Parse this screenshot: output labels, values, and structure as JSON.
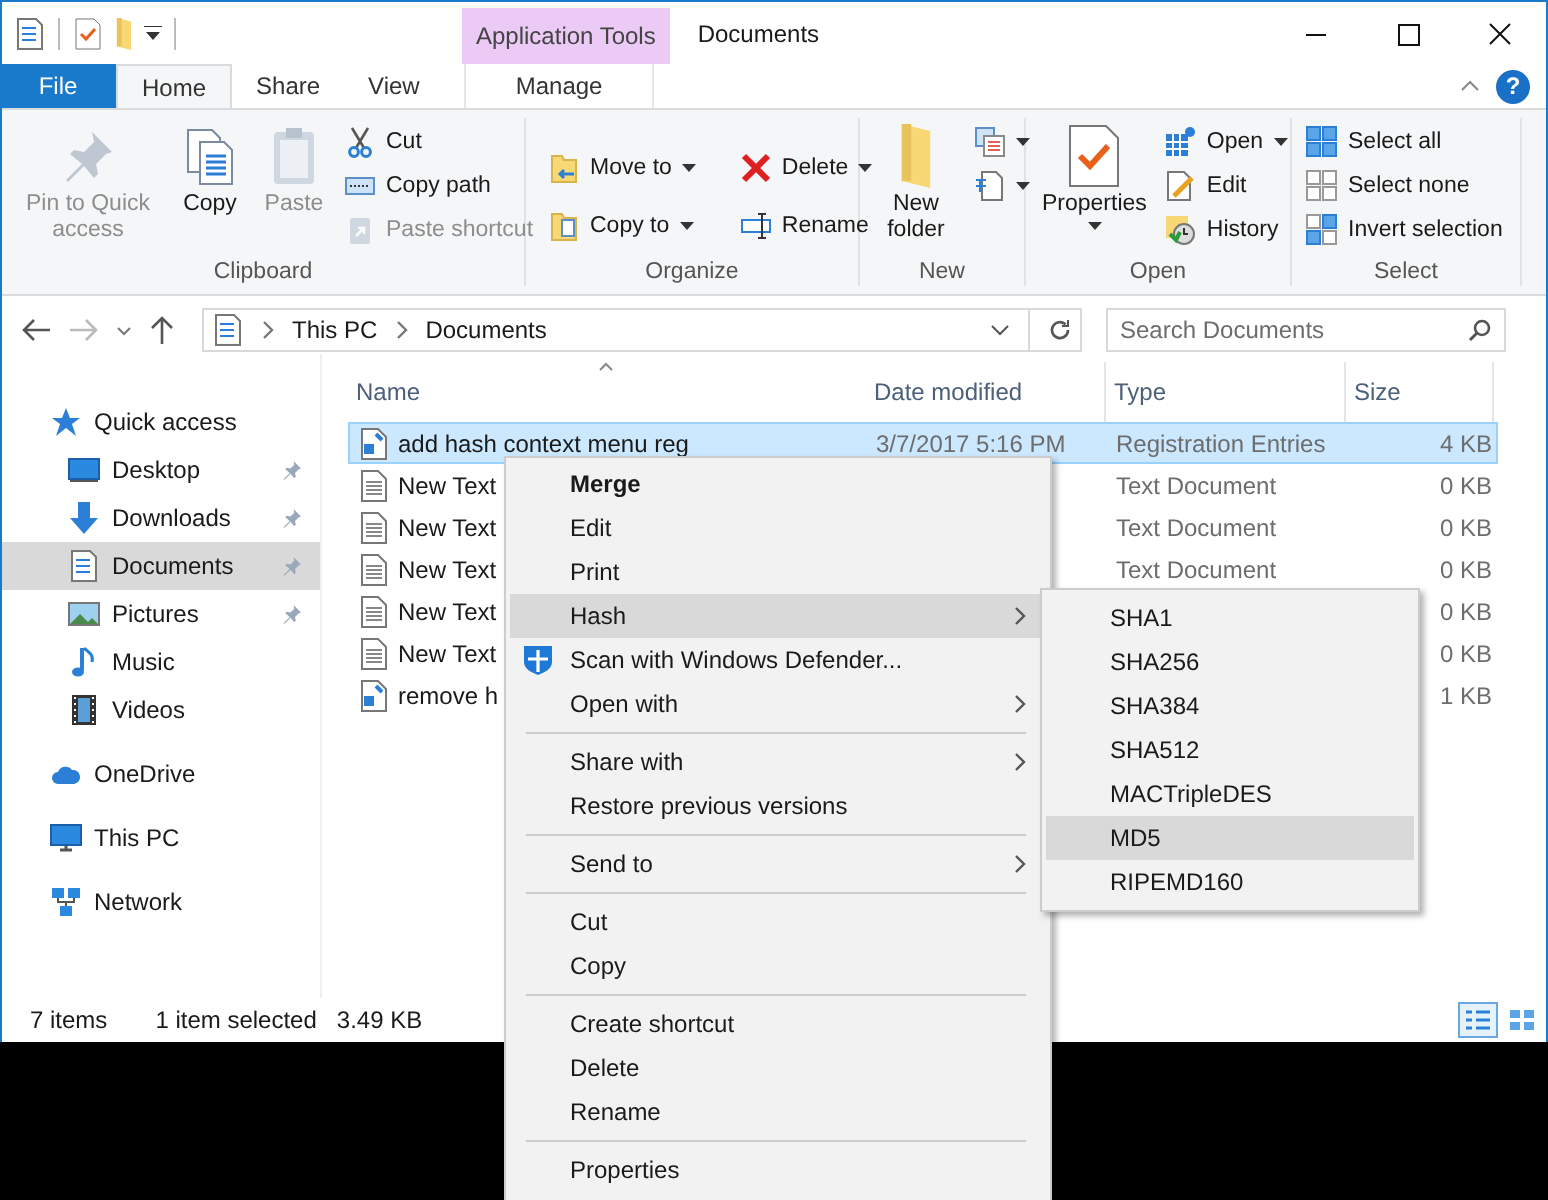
{
  "window": {
    "title": "Documents",
    "contextual_tab_group": "Application Tools",
    "help": "?"
  },
  "ribbon_tabs": [
    {
      "label": "File",
      "kind": "file",
      "selected": false
    },
    {
      "label": "Home",
      "kind": "tab",
      "selected": true
    },
    {
      "label": "Share",
      "kind": "tab",
      "selected": false
    },
    {
      "label": "View",
      "kind": "tab",
      "selected": false
    },
    {
      "label": "Manage",
      "kind": "contextual",
      "selected": false
    }
  ],
  "ribbon_groups": [
    {
      "label": "Clipboard",
      "large_buttons": [
        {
          "label": "Pin to Quick access",
          "disabled": true,
          "dropdown": false
        },
        {
          "label": "Copy",
          "disabled": false,
          "dropdown": false
        },
        {
          "label": "Paste",
          "disabled": true,
          "dropdown": false
        }
      ],
      "small_buttons": [
        {
          "label": "Cut",
          "disabled": false,
          "dropdown": false
        },
        {
          "label": "Copy path",
          "disabled": false,
          "dropdown": false
        },
        {
          "label": "Paste shortcut",
          "disabled": true,
          "dropdown": false
        }
      ]
    },
    {
      "label": "Organize",
      "small_buttons": [
        {
          "label": "Move to",
          "disabled": false,
          "dropdown": true
        },
        {
          "label": "Copy to",
          "disabled": false,
          "dropdown": true
        },
        {
          "label": "Delete",
          "disabled": false,
          "dropdown": true
        },
        {
          "label": "Rename",
          "disabled": false,
          "dropdown": false
        }
      ]
    },
    {
      "label": "New",
      "large_buttons": [
        {
          "label": "New folder",
          "disabled": false,
          "dropdown": false
        }
      ],
      "small_buttons": [
        {
          "disabled": false,
          "dropdown": true
        },
        {
          "disabled": false,
          "dropdown": true
        }
      ]
    },
    {
      "label": "Open",
      "large_buttons": [
        {
          "label": "Properties",
          "disabled": false,
          "dropdown": true
        }
      ],
      "small_buttons": [
        {
          "label": "Open",
          "disabled": false,
          "dropdown": true
        },
        {
          "label": "Edit",
          "disabled": false,
          "dropdown": false
        },
        {
          "label": "History",
          "disabled": false,
          "dropdown": false
        }
      ]
    },
    {
      "label": "Select",
      "small_buttons": [
        {
          "label": "Select all",
          "disabled": false,
          "dropdown": false
        },
        {
          "label": "Select none",
          "disabled": false,
          "dropdown": false
        },
        {
          "label": "Invert selection",
          "disabled": false,
          "dropdown": false
        }
      ]
    }
  ],
  "address_bar": {
    "path": [
      "This PC",
      "Documents"
    ]
  },
  "search": {
    "placeholder": "Search Documents"
  },
  "navigation_pane": [
    {
      "label": "Quick access",
      "selected": false,
      "pinned": false,
      "children": [
        {
          "label": "Desktop",
          "selected": false,
          "pinned": true
        },
        {
          "label": "Downloads",
          "selected": false,
          "pinned": true
        },
        {
          "label": "Documents",
          "selected": true,
          "pinned": true
        },
        {
          "label": "Pictures",
          "selected": false,
          "pinned": true
        },
        {
          "label": "Music",
          "selected": false,
          "pinned": false
        },
        {
          "label": "Videos",
          "selected": false,
          "pinned": false
        }
      ]
    },
    {
      "label": "OneDrive",
      "selected": false,
      "pinned": false
    },
    {
      "label": "This PC",
      "selected": false,
      "pinned": false
    },
    {
      "label": "Network",
      "selected": false,
      "pinned": false
    }
  ],
  "file_list": {
    "columns": [
      "Name",
      "Date modified",
      "Type",
      "Size"
    ],
    "rows": [
      {
        "kind": "reg",
        "name": "add hash context menu reg",
        "date_modified": "3/7/2017 5:16 PM",
        "type": "Registration Entries",
        "size": "4 KB",
        "selected": true
      },
      {
        "kind": "text",
        "name": "New Text",
        "type": "Text Document",
        "size": "0 KB",
        "selected": false
      },
      {
        "kind": "text",
        "name": "New Text",
        "type": "Text Document",
        "size": "0 KB",
        "selected": false
      },
      {
        "kind": "text",
        "name": "New Text",
        "type": "Text Document",
        "size": "0 KB",
        "selected": false
      },
      {
        "kind": "text",
        "name": "New Text",
        "size": "0 KB",
        "selected": false
      },
      {
        "kind": "text",
        "name": "New Text",
        "size": "0 KB",
        "selected": false
      },
      {
        "kind": "reg",
        "name": "remove h",
        "size": "1 KB",
        "selected": false
      }
    ]
  },
  "status_bar": {
    "item_count": "7 items",
    "selection": "1 item selected",
    "selection_size": "3.49 KB",
    "views": [
      {
        "kind": "details",
        "selected": true
      },
      {
        "kind": "large_icons",
        "selected": false
      }
    ]
  },
  "context_menu": {
    "items": [
      {
        "kind": "item",
        "label": "Merge",
        "default": true,
        "submenu": false,
        "selected": false
      },
      {
        "kind": "item",
        "label": "Edit",
        "default": false,
        "submenu": false,
        "selected": false
      },
      {
        "kind": "item",
        "label": "Print",
        "default": false,
        "submenu": false,
        "selected": false
      },
      {
        "kind": "item",
        "label": "Hash",
        "default": false,
        "submenu": true,
        "selected": true
      },
      {
        "kind": "shield_item",
        "label": "Scan with Windows Defender...",
        "default": false,
        "submenu": false,
        "selected": false
      },
      {
        "kind": "item",
        "label": "Open with",
        "default": false,
        "submenu": true,
        "selected": false
      },
      {
        "kind": "separator"
      },
      {
        "kind": "item",
        "label": "Share with",
        "default": false,
        "submenu": true,
        "selected": false
      },
      {
        "kind": "item",
        "label": "Restore previous versions",
        "default": false,
        "submenu": false,
        "selected": false
      },
      {
        "kind": "separator"
      },
      {
        "kind": "item",
        "label": "Send to",
        "default": false,
        "submenu": true,
        "selected": false
      },
      {
        "kind": "separator"
      },
      {
        "kind": "item",
        "label": "Cut",
        "default": false,
        "submenu": false,
        "selected": false
      },
      {
        "kind": "item",
        "label": "Copy",
        "default": false,
        "submenu": false,
        "selected": false
      },
      {
        "kind": "separator"
      },
      {
        "kind": "item",
        "label": "Create shortcut",
        "default": false,
        "submenu": false,
        "selected": false
      },
      {
        "kind": "item",
        "label": "Delete",
        "default": false,
        "submenu": false,
        "selected": false
      },
      {
        "kind": "item",
        "label": "Rename",
        "default": false,
        "submenu": false,
        "selected": false
      },
      {
        "kind": "separator"
      },
      {
        "kind": "item",
        "label": "Properties",
        "default": false,
        "submenu": false,
        "selected": false
      }
    ]
  },
  "hash_submenu": {
    "items": [
      {
        "label": "SHA1",
        "selected": false
      },
      {
        "label": "SHA256",
        "selected": false
      },
      {
        "label": "SHA384",
        "selected": false
      },
      {
        "label": "SHA512",
        "selected": false
      },
      {
        "label": "MACTripleDES",
        "selected": false
      },
      {
        "label": "MD5",
        "selected": true
      },
      {
        "label": "RIPEMD160",
        "selected": false
      }
    ]
  }
}
